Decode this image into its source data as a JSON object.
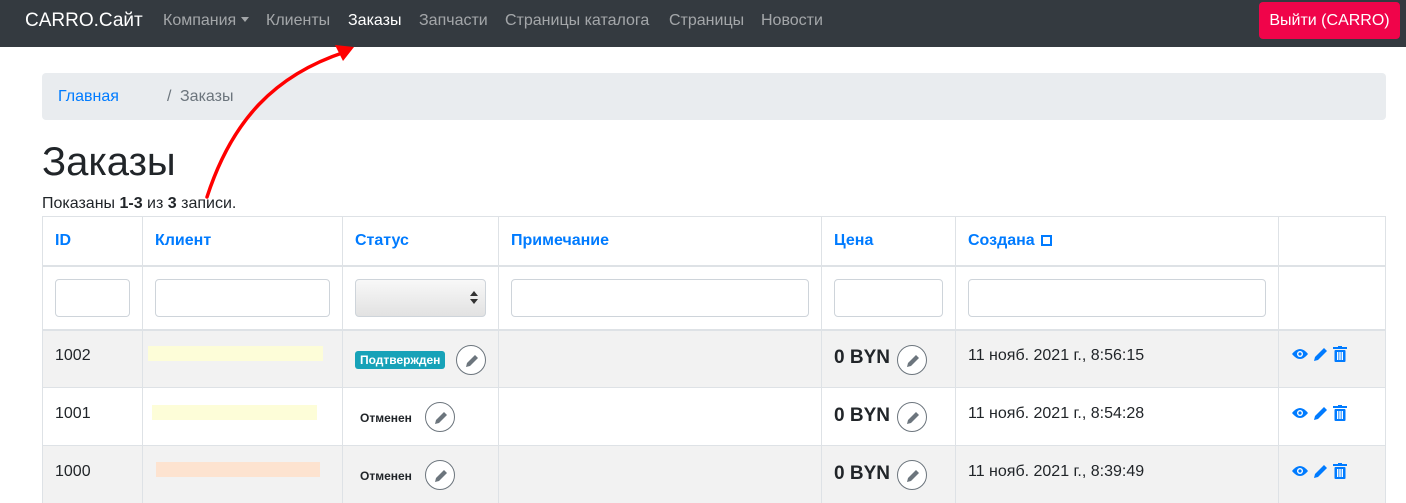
{
  "navbar": {
    "brand": "CARRO.Сайт",
    "items": [
      {
        "label": "Компания",
        "dropdown": true
      },
      {
        "label": "Клиенты"
      },
      {
        "label": "Заказы",
        "active": true
      },
      {
        "label": "Запчасти"
      },
      {
        "label": "Страницы каталога"
      },
      {
        "label": "Страницы"
      },
      {
        "label": "Новости"
      }
    ],
    "logout_label": "Выйти (CARRO)"
  },
  "breadcrumb": {
    "home": "Главная",
    "separator": "/",
    "current": "Заказы"
  },
  "page_title": "Заказы",
  "summary": {
    "prefix": "Показаны ",
    "range": "1-3",
    "middle": " из ",
    "total": "3",
    "suffix": " записи."
  },
  "table": {
    "headers": {
      "id": "ID",
      "client": "Клиент",
      "status": "Статус",
      "note": "Примечание",
      "price": "Цена",
      "created": "Создана"
    },
    "rows": [
      {
        "id": "1002",
        "status": "Подтвержден",
        "status_badge": true,
        "note": "",
        "price": "0 BYN",
        "created": "11 нояб. 2021 г., 8:56:15"
      },
      {
        "id": "1001",
        "status": "Отменен",
        "status_badge": false,
        "note": "",
        "price": "0 BYN",
        "created": "11 нояб. 2021 г., 8:54:28"
      },
      {
        "id": "1000",
        "status": "Отменен",
        "status_badge": false,
        "note": "",
        "price": "0 BYN",
        "created": "11 нояб. 2021 г., 8:39:49"
      }
    ]
  },
  "colors": {
    "navbar_bg": "#343a40",
    "logout_bg": "#f0044a",
    "link": "#007bff",
    "badge_info": "#17a2b8",
    "annotation_arrow": "#ff0000"
  }
}
